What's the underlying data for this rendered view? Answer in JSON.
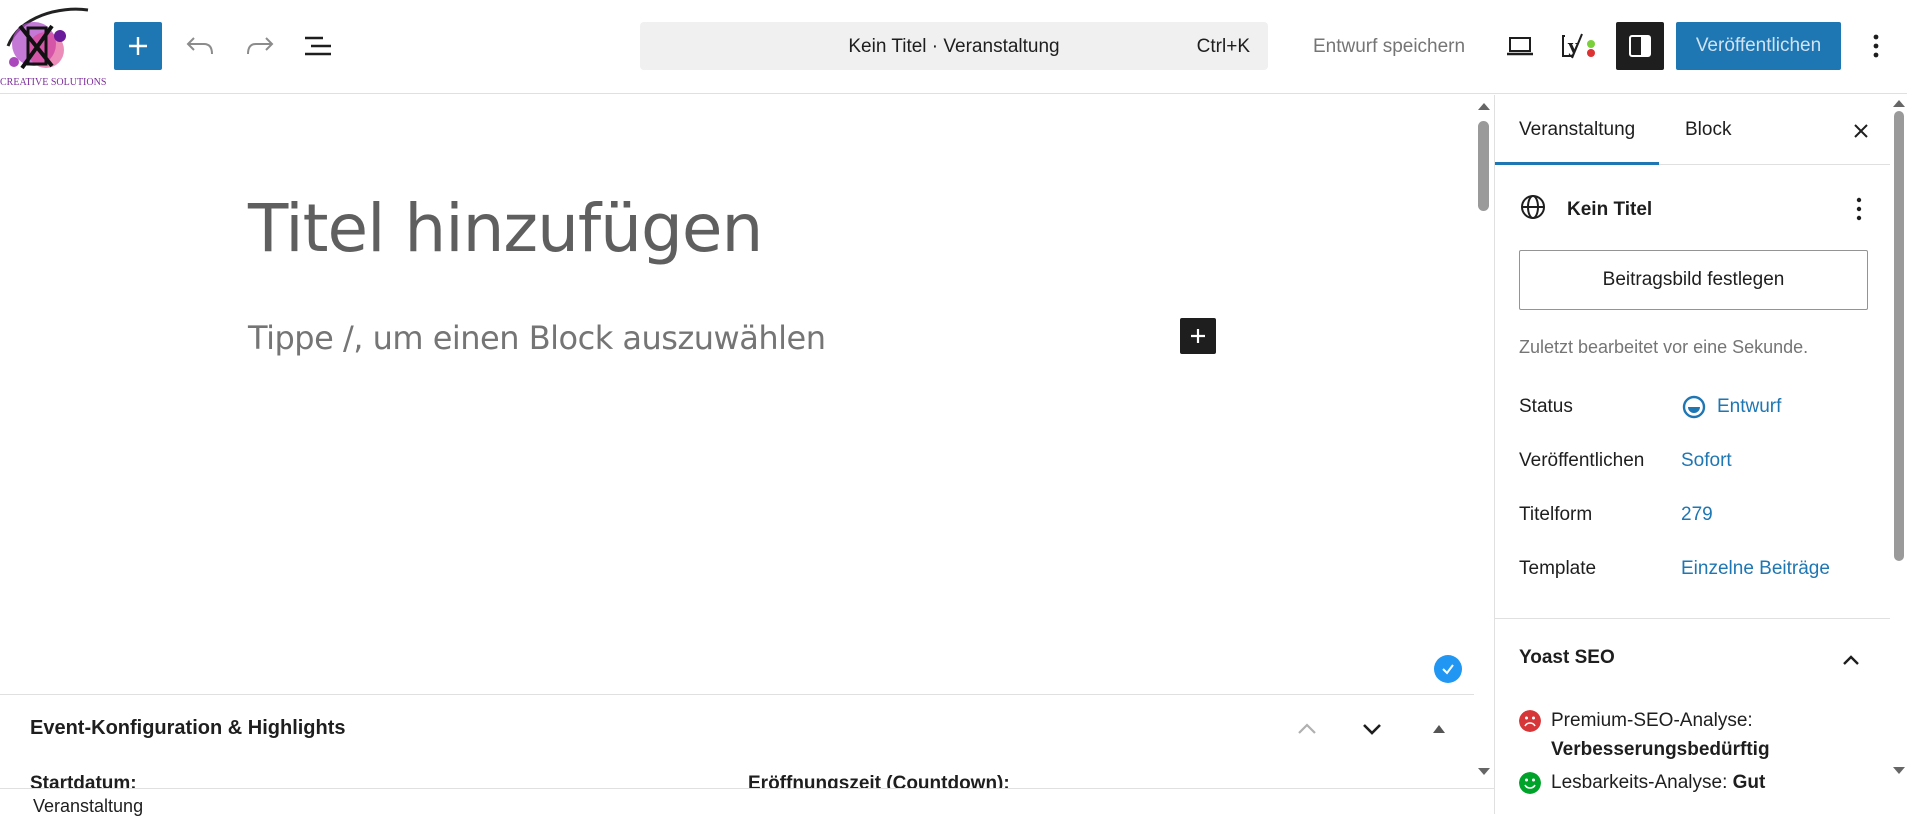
{
  "logo": {
    "text": "CREATIVE SOLUTIONS"
  },
  "toolbar": {
    "add_block_label": "+",
    "document_title": "Kein Titel · Veranstaltung",
    "shortcut": "Ctrl+K",
    "save_draft_label": "Entwurf speichern",
    "publish_label": "Veröffentlichen"
  },
  "editor": {
    "title_placeholder": "Titel hinzufügen",
    "block_placeholder": "Tippe /, um einen Block auszuwählen"
  },
  "metabox": {
    "title": "Event-Konfiguration & Highlights",
    "field_start_date": "Startdatum:",
    "field_opening_time": "Eröffnungszeit (Countdown):"
  },
  "footer": {
    "breadcrumb": "Veranstaltung"
  },
  "sidebar": {
    "tabs": [
      {
        "label": "Veranstaltung",
        "active": true
      },
      {
        "label": "Block",
        "active": false
      }
    ],
    "post_title": "Kein Titel",
    "featured_image_button": "Beitragsbild festlegen",
    "last_edited": "Zuletzt bearbeitet vor eine Sekunde.",
    "rows": [
      {
        "label": "Status",
        "value": "Entwurf"
      },
      {
        "label": "Veröffentlichen",
        "value": "Sofort"
      },
      {
        "label": "Titelform",
        "value": "279"
      },
      {
        "label": "Template",
        "value": "Einzelne Beiträge"
      }
    ],
    "yoast": {
      "title": "Yoast SEO",
      "seo_label": "Premium-SEO-Analyse:",
      "seo_value": "Verbesserungsbedürftig",
      "readability_label": "Lesbarkeits-Analyse:",
      "readability_value": "Gut"
    }
  },
  "colors": {
    "accent": "#1e76b3",
    "dark": "#1e1e1e",
    "bad": "#d63638",
    "good": "#00a32a"
  }
}
